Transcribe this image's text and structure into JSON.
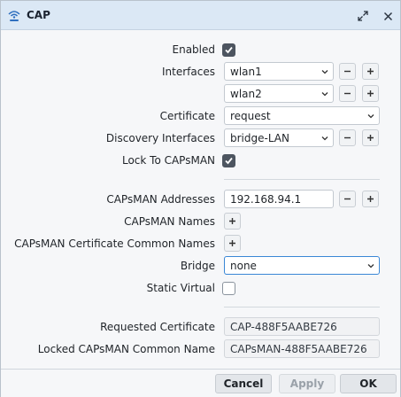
{
  "window": {
    "title": "CAP"
  },
  "form": {
    "enabled_label": "Enabled",
    "enabled": true,
    "interfaces_label": "Interfaces",
    "interfaces": [
      "wlan1",
      "wlan2"
    ],
    "certificate_label": "Certificate",
    "certificate": "request",
    "discovery_label": "Discovery Interfaces",
    "discovery": "bridge-LAN",
    "lock_label": "Lock To CAPsMAN",
    "lock": true,
    "addresses_label": "CAPsMAN Addresses",
    "addresses": "192.168.94.1",
    "names_label": "CAPsMAN Names",
    "cert_common_names_label": "CAPsMAN Certificate Common Names",
    "bridge_label": "Bridge",
    "bridge": "none",
    "static_virtual_label": "Static Virtual",
    "static_virtual": false,
    "requested_cert_label": "Requested Certificate",
    "requested_cert": "CAP-488F5AABE726",
    "locked_common_name_label": "Locked CAPsMAN Common Name",
    "locked_common_name": "CAPsMAN-488F5AABE726"
  },
  "buttons": {
    "cancel": "Cancel",
    "apply": "Apply",
    "ok": "OK"
  },
  "colors": {
    "titlebar": "#dbe8f5",
    "accent_focus": "#3a87d6",
    "checkbox_checked": "#4d5560"
  }
}
